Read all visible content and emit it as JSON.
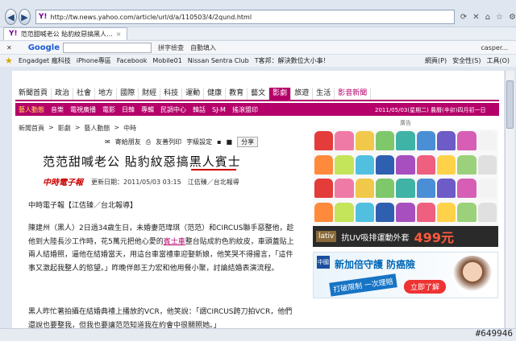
{
  "browser": {
    "url": "http://tw.news.yahoo.com/article/url/d/a/110503/4/2qund.html",
    "tab_title": "范范甜喊老公 貼豹紋惡搞黑人...",
    "google_label": "Google",
    "toolbar_items": [
      "拼字檢查",
      "自動填入",
      "casper..."
    ],
    "favorites": [
      "Engadget 瘋科技",
      "iPhone專區",
      "Facebook",
      "Mobile01",
      "Nissan Sentra Club",
      "T客邦：解決數位大小事！"
    ],
    "right_tools": [
      "網頁(P)",
      "安全性(S)",
      "工具(O)"
    ]
  },
  "nav": {
    "main": [
      "新聞首頁",
      "政治",
      "社會",
      "地方",
      "國際",
      "財經",
      "科技",
      "運動",
      "健康",
      "教育",
      "藝文",
      "影劇",
      "旅遊",
      "生活",
      "影音新聞"
    ],
    "active": "影劇",
    "sub": [
      "藝人動態",
      "音樂",
      "電視廣播",
      "電影",
      "日韓",
      "專輯",
      "民調中心",
      "韓話",
      "SJ-M",
      "搖滾盟印"
    ],
    "date": "2011/05/03(星期二) 農曆(辛卯)四月初一日"
  },
  "breadcrumb": [
    "新聞首頁",
    ">",
    "影劇",
    ">",
    "藝人動態",
    ">",
    "中時"
  ],
  "tools": {
    "mail": "寄給朋友",
    "print": "友善列印",
    "size": "字級設定",
    "share": "分享"
  },
  "article": {
    "title": "范范甜喊老公 貼豹紋惡搞黑人賓士",
    "source_logo": "中時電子報",
    "meta": "更新日期：2011/05/03 03:15　江佶臻／台北報導",
    "byline": "中時電子報【江佶臻／台北報導】",
    "p1_a": "陳建州（黑人）2日過34歲生日，未婚妻范瑋琪（范范）和CIRCUS聯手惡整他，趁他到大陸長沙工作時，花5萬元把他心愛的",
    "p1_hl": "賓士車",
    "p1_b": "整台貼成豹色豹紋皮，車頭蓋貼上兩人結婚照，逼他在結婚當天，用這台車當禮車迎娶新娘，他笑哭不得揚言，「這件事又激起我整人的慾望。」昨晚伴郎王力宏和他用餐小聚，討論結婚表演流程。",
    "p2": "黑人昨忙著拍攝在結婚典禮上播放的VCR，他笑說：「謂CIRCUS跨刀拍VCR，他們還說也要整我，但我也要讓范范知道我在約會中很關照她。」"
  },
  "ad": {
    "label": "廣告",
    "brand": "lativ",
    "text": "抗UV吸排運動外套",
    "price": "499元",
    "insurer_logo": "中國",
    "insurer_title": "新加倍守護 防癌險",
    "slogan": "打破限制 一次理賠",
    "button": "立即了解"
  },
  "watermark": "#649946",
  "colors": {
    "accent": "#b5006a",
    "link": "#0067b5"
  }
}
